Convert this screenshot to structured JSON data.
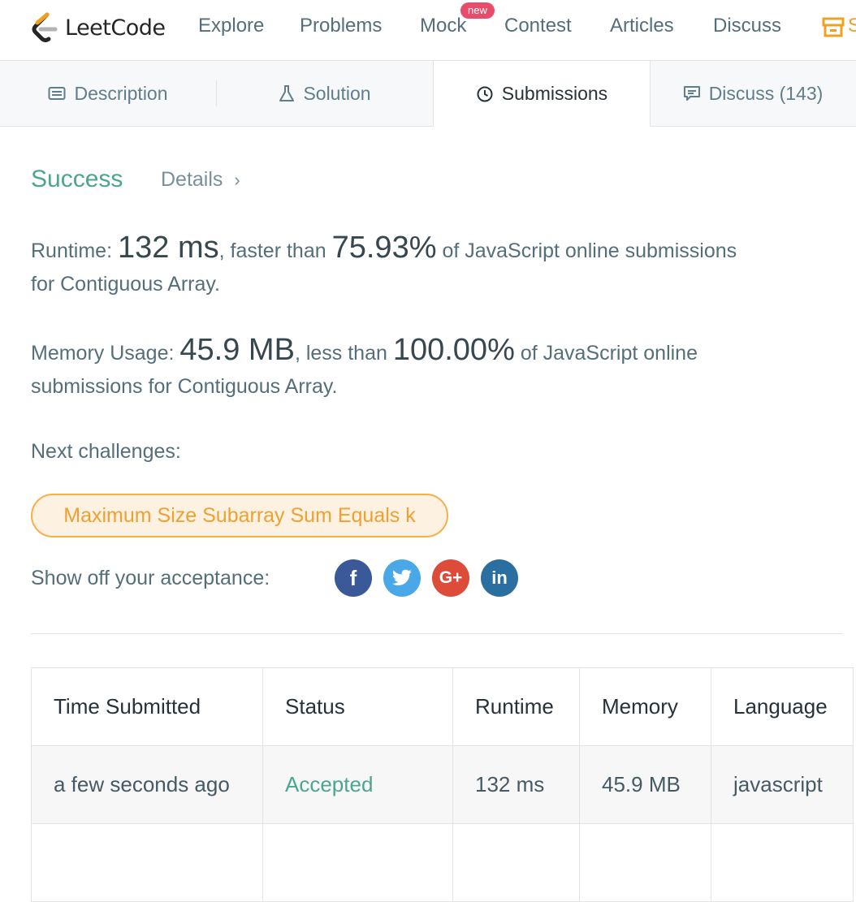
{
  "app": {
    "logo_text": "LeetCode",
    "nav": [
      "Explore",
      "Problems",
      "Mock",
      "Contest",
      "Articles",
      "Discuss"
    ],
    "badge_new": "new",
    "store_partial": "S"
  },
  "tabs": [
    {
      "label": "Description",
      "icon": "description-icon"
    },
    {
      "label": "Solution",
      "icon": "flask-icon"
    },
    {
      "label": "Submissions",
      "icon": "clock-icon",
      "active": true
    },
    {
      "label": "Discuss (143)",
      "icon": "discuss-icon"
    }
  ],
  "result": {
    "status": "Success",
    "details_label": "Details",
    "runtime_label": "Runtime:",
    "runtime_value": "132 ms",
    "runtime_mid": ", faster than",
    "runtime_pct": "75.93%",
    "runtime_tail_1": "of JavaScript online submissions",
    "runtime_tail_2": "for Contiguous Array.",
    "memory_label": "Memory Usage:",
    "memory_value": "45.9 MB",
    "memory_mid": ", less than",
    "memory_pct": "100.00%",
    "memory_tail_1": "of JavaScript online",
    "memory_tail_2": "submissions for Contiguous Array."
  },
  "next_challenges": {
    "label": "Next challenges:",
    "items": [
      "Maximum Size Subarray Sum Equals k"
    ]
  },
  "share": {
    "label": "Show off your acceptance:",
    "networks": [
      {
        "icon": "facebook-icon",
        "glyph": "f",
        "color": "#3b5998"
      },
      {
        "icon": "twitter-icon",
        "glyph": "🐦",
        "color": "#4aa8e8"
      },
      {
        "icon": "google-plus-icon",
        "glyph": "G+",
        "color": "#dd4b39"
      },
      {
        "icon": "linkedin-icon",
        "glyph": "in",
        "color": "#2a6fa0"
      }
    ]
  },
  "submissions": {
    "headers": [
      "Time Submitted",
      "Status",
      "Runtime",
      "Memory",
      "Language"
    ],
    "rows": [
      [
        "a few seconds ago",
        "Accepted",
        "132 ms",
        "45.9 MB",
        "javascript"
      ]
    ]
  },
  "colors": {
    "accent_green": "#4ca58f",
    "accent_orange": "#f0a030",
    "badge_red": "#e74c6b"
  }
}
